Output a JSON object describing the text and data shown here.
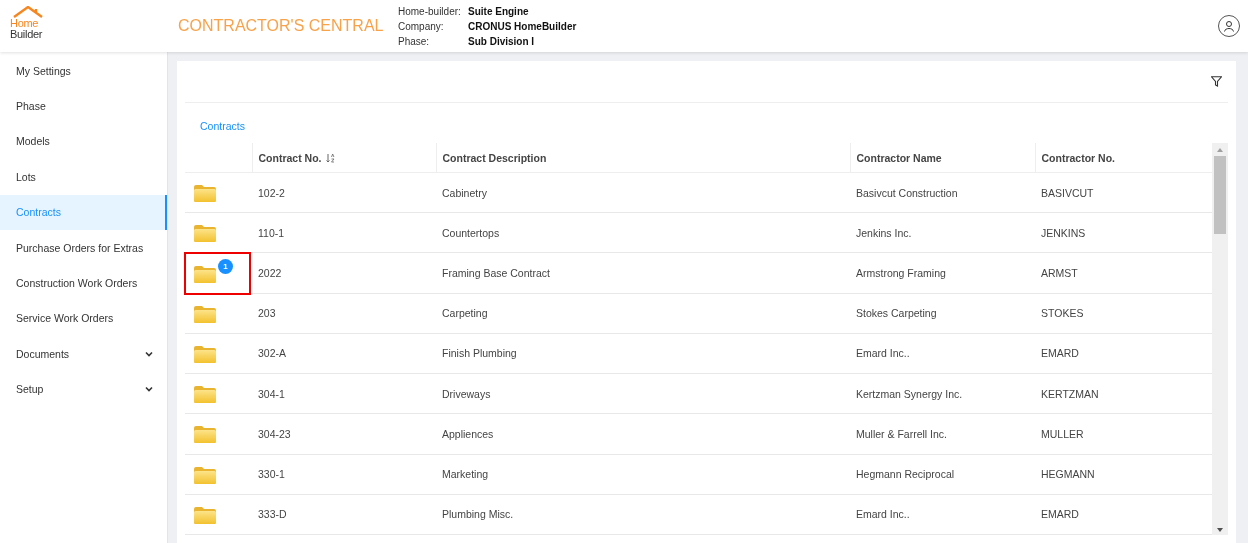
{
  "header": {
    "logo_top": "Home",
    "logo_bottom": "Builder",
    "title": "CONTRACTOR'S CENTRAL",
    "info": [
      {
        "label": "Home-builder:",
        "value": "Suite Engine"
      },
      {
        "label": "Company:",
        "value": "CRONUS HomeBuilder"
      },
      {
        "label": "Phase:",
        "value": "Sub Division I"
      }
    ]
  },
  "sidebar": {
    "items": [
      {
        "label": "My Settings",
        "selected": false
      },
      {
        "label": "Phase",
        "selected": false
      },
      {
        "label": "Models",
        "selected": false
      },
      {
        "label": "Lots",
        "selected": false
      },
      {
        "label": "Contracts",
        "selected": true
      },
      {
        "label": "Purchase Orders for Extras",
        "selected": false
      },
      {
        "label": "Construction Work Orders",
        "selected": false
      },
      {
        "label": "Service Work Orders",
        "selected": false
      },
      {
        "label": "Documents",
        "selected": false,
        "expanded": false
      },
      {
        "label": "Setup",
        "selected": false,
        "expanded": false
      }
    ]
  },
  "breadcrumb": "Contracts",
  "table": {
    "columns": [
      {
        "label": "Contract No.",
        "kind": "sortable"
      },
      {
        "label": "Contract Description",
        "kind": "plain"
      },
      {
        "label": "Contractor Name",
        "kind": "plain"
      },
      {
        "label": "Contractor No.",
        "kind": "plain"
      }
    ],
    "rows": [
      {
        "cells": [
          "102-2",
          "Cabinetry",
          "Basivcut Construction",
          "BASIVCUT"
        ],
        "highlighted": false
      },
      {
        "cells": [
          "110-1",
          "Countertops",
          "Jenkins Inc.",
          "JENKINS"
        ],
        "highlighted": false
      },
      {
        "cells": [
          "2022",
          "Framing Base Contract",
          "Armstrong Framing",
          "ARMST"
        ],
        "badge": "1",
        "highlighted": true
      },
      {
        "cells": [
          "203",
          "Carpeting",
          "Stokes Carpeting",
          "STOKES"
        ],
        "highlighted": false
      },
      {
        "cells": [
          "302-A",
          "Finish Plumbing",
          "Emard Inc..",
          "EMARD"
        ],
        "highlighted": false
      },
      {
        "cells": [
          "304-1",
          "Driveways",
          "Kertzman Synergy Inc.",
          "KERTZMAN"
        ],
        "highlighted": false
      },
      {
        "cells": [
          "304-23",
          "Appliences",
          "Muller & Farrell Inc.",
          "MULLER"
        ],
        "highlighted": false
      },
      {
        "cells": [
          "330-1",
          "Marketing",
          "Hegmann Reciprocal",
          "HEGMANN"
        ],
        "highlighted": false
      },
      {
        "cells": [
          "333-D",
          "Plumbing Misc.",
          "Emard Inc..",
          "EMARD"
        ],
        "highlighted": false
      }
    ]
  }
}
